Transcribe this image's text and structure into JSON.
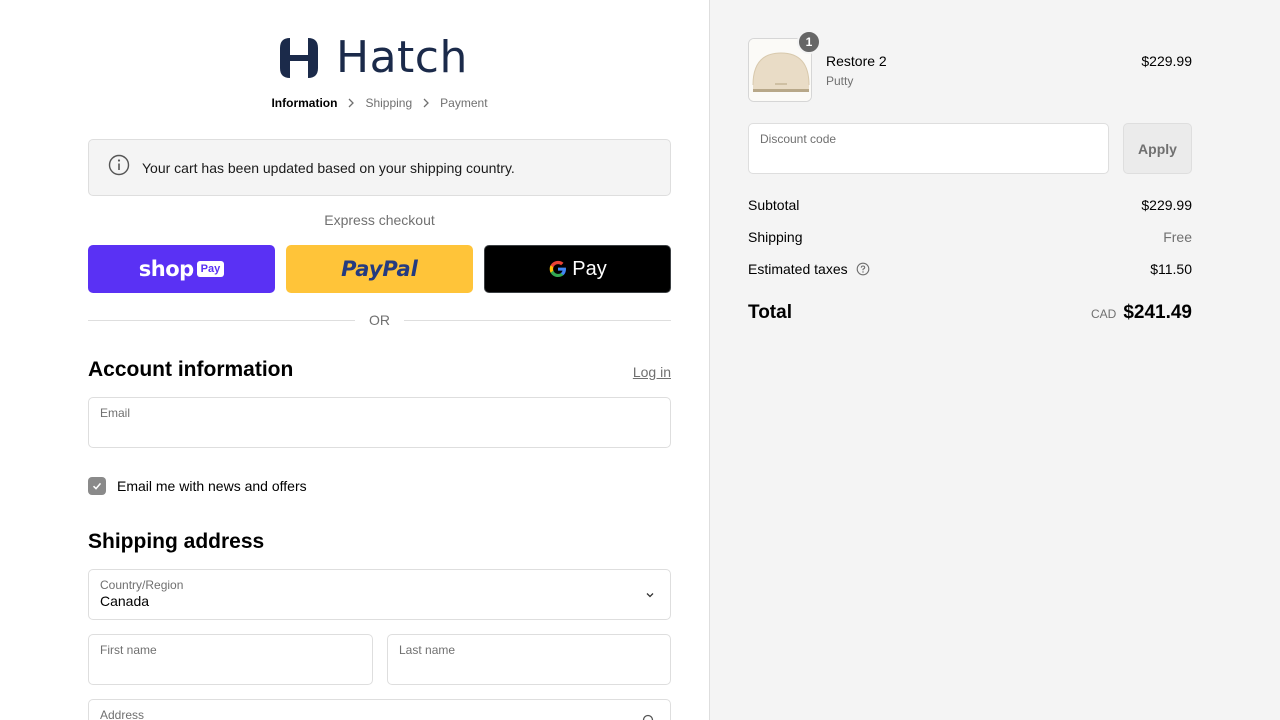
{
  "brand": {
    "name": "Hatch"
  },
  "breadcrumb": {
    "items": [
      "Information",
      "Shipping",
      "Payment"
    ]
  },
  "banner": {
    "text": "Your cart has been updated based on your shipping country."
  },
  "express": {
    "label": "Express checkout",
    "shop_pay": "shop",
    "shop_pay_badge": "Pay",
    "paypal": "PayPal",
    "gpay": "Pay"
  },
  "divider": {
    "or": "OR"
  },
  "account": {
    "title": "Account information",
    "login": "Log in",
    "email_label": "Email",
    "email_value": "",
    "newsletter": "Email me with news and offers",
    "newsletter_checked": true
  },
  "shipping": {
    "title": "Shipping address",
    "country_label": "Country/Region",
    "country_value": "Canada",
    "first_name_label": "First name",
    "last_name_label": "Last name",
    "address_label": "Address"
  },
  "summary": {
    "item": {
      "name": "Restore 2",
      "variant": "Putty",
      "price": "$229.99",
      "quantity": "1"
    },
    "discount": {
      "label": "Discount code",
      "apply": "Apply"
    },
    "subtotal_label": "Subtotal",
    "subtotal_value": "$229.99",
    "shipping_label": "Shipping",
    "shipping_value": "Free",
    "taxes_label": "Estimated taxes",
    "taxes_value": "$11.50",
    "total_label": "Total",
    "currency": "CAD",
    "total_value": "$241.49"
  },
  "colors": {
    "shop_pay": "#5a31f4",
    "paypal": "#ffc439",
    "gpay": "#000000",
    "logo": "#1b2a4a"
  }
}
